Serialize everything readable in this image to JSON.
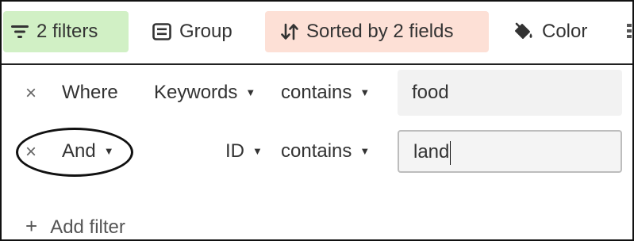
{
  "toolbar": {
    "filters_label": "2 filters",
    "group_label": "Group",
    "sorted_label": "Sorted by 2 fields",
    "color_label": "Color",
    "filters_bg": "#d1f0c5",
    "sorted_bg": "#fde0d6",
    "icons": [
      "filter-icon",
      "group-icon",
      "sort-icon",
      "paint-bucket-icon",
      "overflow-icon"
    ]
  },
  "filters": [
    {
      "remove_glyph": "×",
      "conjunction": "Where",
      "field": "Keywords",
      "operator": "contains",
      "value": "food"
    },
    {
      "remove_glyph": "×",
      "conjunction": "And",
      "field": "ID",
      "operator": "contains",
      "value": "land"
    }
  ],
  "caret_glyph": "▼",
  "add_filter": {
    "plus": "+",
    "label": "Add filter"
  }
}
